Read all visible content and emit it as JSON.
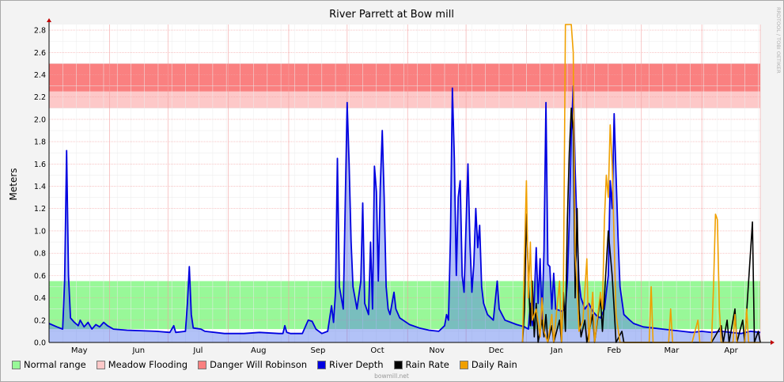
{
  "chart_data": {
    "type": "line",
    "title": "River Parrett at Bow mill",
    "watermark": "RRDTOOL / TOBI OETIKER",
    "footer": "bowmill.net",
    "ylabel": "Meters",
    "ylim": [
      0,
      2.85
    ],
    "yticks": [
      "0.0",
      "0.2",
      "0.4",
      "0.6",
      "0.8",
      "1.0",
      "1.2",
      "1.4",
      "1.6",
      "1.8",
      "2.0",
      "2.2",
      "2.4",
      "2.6",
      "2.8"
    ],
    "xlabels": [
      "May",
      "Jun",
      "Jul",
      "Aug",
      "Sep",
      "Oct",
      "Nov",
      "Dec",
      "Jan",
      "Feb",
      "Mar",
      "Apr"
    ],
    "xlim_days": [
      0,
      365
    ],
    "grid": true,
    "bands": [
      {
        "name": "Normal range",
        "from": 0.12,
        "to": 0.55,
        "color": "#98f898"
      },
      {
        "name": "Meadow Flooding",
        "from": 2.1,
        "to": 2.25,
        "color": "#fdc8c8"
      },
      {
        "name": "Danger Will Robinson",
        "from": 2.25,
        "to": 2.5,
        "color": "#fa8080"
      }
    ],
    "series": [
      {
        "name": "River Depth",
        "color": "#0000e0",
        "points": [
          [
            0,
            0.17
          ],
          [
            4,
            0.14
          ],
          [
            7,
            0.12
          ],
          [
            8,
            0.55
          ],
          [
            9,
            1.72
          ],
          [
            10,
            0.6
          ],
          [
            11,
            0.22
          ],
          [
            13,
            0.18
          ],
          [
            15,
            0.15
          ],
          [
            16,
            0.2
          ],
          [
            18,
            0.14
          ],
          [
            20,
            0.18
          ],
          [
            22,
            0.12
          ],
          [
            24,
            0.16
          ],
          [
            26,
            0.14
          ],
          [
            28,
            0.18
          ],
          [
            30,
            0.15
          ],
          [
            33,
            0.12
          ],
          [
            40,
            0.11
          ],
          [
            55,
            0.1
          ],
          [
            62,
            0.09
          ],
          [
            64,
            0.15
          ],
          [
            65,
            0.09
          ],
          [
            70,
            0.1
          ],
          [
            71,
            0.35
          ],
          [
            72,
            0.68
          ],
          [
            73,
            0.25
          ],
          [
            74,
            0.13
          ],
          [
            78,
            0.12
          ],
          [
            80,
            0.1
          ],
          [
            90,
            0.08
          ],
          [
            100,
            0.08
          ],
          [
            108,
            0.09
          ],
          [
            118,
            0.08
          ],
          [
            120,
            0.08
          ],
          [
            121,
            0.15
          ],
          [
            122,
            0.09
          ],
          [
            124,
            0.08
          ],
          [
            130,
            0.08
          ],
          [
            133,
            0.2
          ],
          [
            135,
            0.19
          ],
          [
            137,
            0.12
          ],
          [
            140,
            0.08
          ],
          [
            143,
            0.1
          ],
          [
            145,
            0.33
          ],
          [
            146,
            0.18
          ],
          [
            147,
            0.45
          ],
          [
            148,
            1.65
          ],
          [
            149,
            0.5
          ],
          [
            151,
            0.3
          ],
          [
            153,
            2.15
          ],
          [
            154,
            1.6
          ],
          [
            155,
            0.9
          ],
          [
            156,
            0.5
          ],
          [
            158,
            0.3
          ],
          [
            160,
            0.55
          ],
          [
            161,
            1.25
          ],
          [
            162,
            0.35
          ],
          [
            164,
            0.25
          ],
          [
            165,
            0.9
          ],
          [
            166,
            0.3
          ],
          [
            167,
            1.58
          ],
          [
            168,
            1.35
          ],
          [
            169,
            0.55
          ],
          [
            170,
            1.4
          ],
          [
            171,
            1.9
          ],
          [
            172,
            1.3
          ],
          [
            173,
            0.5
          ],
          [
            174,
            0.3
          ],
          [
            175,
            0.25
          ],
          [
            177,
            0.45
          ],
          [
            178,
            0.3
          ],
          [
            180,
            0.22
          ],
          [
            185,
            0.16
          ],
          [
            190,
            0.13
          ],
          [
            195,
            0.11
          ],
          [
            200,
            0.1
          ],
          [
            203,
            0.15
          ],
          [
            204,
            0.25
          ],
          [
            205,
            0.2
          ],
          [
            206,
            0.95
          ],
          [
            207,
            2.28
          ],
          [
            208,
            1.65
          ],
          [
            209,
            0.6
          ],
          [
            210,
            1.3
          ],
          [
            211,
            1.45
          ],
          [
            212,
            0.6
          ],
          [
            213,
            0.45
          ],
          [
            214,
            1.05
          ],
          [
            215,
            1.6
          ],
          [
            216,
            0.9
          ],
          [
            217,
            0.45
          ],
          [
            218,
            0.7
          ],
          [
            219,
            1.2
          ],
          [
            220,
            0.85
          ],
          [
            221,
            1.05
          ],
          [
            222,
            0.5
          ],
          [
            223,
            0.35
          ],
          [
            225,
            0.25
          ],
          [
            228,
            0.2
          ],
          [
            230,
            0.55
          ],
          [
            231,
            0.3
          ],
          [
            234,
            0.2
          ],
          [
            240,
            0.16
          ],
          [
            244,
            0.14
          ],
          [
            246,
            0.12
          ],
          [
            247,
            0.35
          ],
          [
            248,
            0.15
          ],
          [
            249,
            0.38
          ],
          [
            250,
            0.85
          ],
          [
            251,
            0.35
          ],
          [
            252,
            0.75
          ],
          [
            253,
            0.2
          ],
          [
            254,
            0.82
          ],
          [
            255,
            2.15
          ],
          [
            256,
            0.7
          ],
          [
            257,
            0.68
          ],
          [
            258,
            0.3
          ],
          [
            259,
            0.62
          ],
          [
            260,
            0.3
          ],
          [
            263,
            0.28
          ],
          [
            265,
            0.3
          ],
          [
            266,
            0.55
          ],
          [
            267,
            1.1
          ],
          [
            268,
            1.85
          ],
          [
            269,
            2.3
          ],
          [
            270,
            1.55
          ],
          [
            271,
            1.0
          ],
          [
            272,
            0.55
          ],
          [
            273,
            0.4
          ],
          [
            275,
            0.3
          ],
          [
            277,
            0.35
          ],
          [
            279,
            0.28
          ],
          [
            281,
            0.24
          ],
          [
            283,
            0.22
          ],
          [
            285,
            0.3
          ],
          [
            287,
            0.6
          ],
          [
            288,
            1.45
          ],
          [
            289,
            1.2
          ],
          [
            290,
            2.05
          ],
          [
            291,
            1.5
          ],
          [
            292,
            0.95
          ],
          [
            293,
            0.5
          ],
          [
            295,
            0.25
          ],
          [
            298,
            0.2
          ],
          [
            300,
            0.17
          ],
          [
            305,
            0.14
          ],
          [
            310,
            0.13
          ],
          [
            315,
            0.12
          ],
          [
            320,
            0.11
          ],
          [
            325,
            0.1
          ],
          [
            330,
            0.09
          ],
          [
            335,
            0.1
          ],
          [
            340,
            0.09
          ],
          [
            345,
            0.1
          ],
          [
            350,
            0.09
          ],
          [
            355,
            0.08
          ],
          [
            360,
            0.1
          ],
          [
            365,
            0.09
          ]
        ]
      },
      {
        "name": "Rain Rate",
        "color": "#000000",
        "points": [
          [
            243,
            0.0
          ],
          [
            244,
            0.3
          ],
          [
            245,
            1.15
          ],
          [
            246,
            0.6
          ],
          [
            247,
            0.15
          ],
          [
            248,
            0.55
          ],
          [
            249,
            0.05
          ],
          [
            250,
            0.35
          ],
          [
            251,
            0.0
          ],
          [
            253,
            0.2
          ],
          [
            254,
            0.05
          ],
          [
            255,
            0.25
          ],
          [
            256,
            0.0
          ],
          [
            258,
            0.15
          ],
          [
            259,
            0.0
          ],
          [
            262,
            0.2
          ],
          [
            263,
            0.0
          ],
          [
            264,
            0.45
          ],
          [
            265,
            0.1
          ],
          [
            266,
            1.1
          ],
          [
            267,
            1.7
          ],
          [
            268,
            2.1
          ],
          [
            269,
            1.9
          ],
          [
            270,
            0.4
          ],
          [
            271,
            1.2
          ],
          [
            272,
            0.3
          ],
          [
            273,
            0.05
          ],
          [
            275,
            0.2
          ],
          [
            276,
            0.0
          ],
          [
            279,
            0.25
          ],
          [
            280,
            0.0
          ],
          [
            283,
            0.4
          ],
          [
            284,
            0.1
          ],
          [
            286,
            0.7
          ],
          [
            287,
            1.0
          ],
          [
            288,
            0.8
          ],
          [
            289,
            0.6
          ],
          [
            290,
            0.3
          ],
          [
            291,
            0.0
          ],
          [
            294,
            0.1
          ],
          [
            295,
            0.0
          ],
          [
            300,
            0.0
          ],
          [
            320,
            0.0
          ],
          [
            340,
            0.0
          ],
          [
            345,
            0.15
          ],
          [
            346,
            0.0
          ],
          [
            348,
            0.2
          ],
          [
            349,
            0.0
          ],
          [
            352,
            0.3
          ],
          [
            353,
            0.0
          ],
          [
            356,
            0.2
          ],
          [
            357,
            0.0
          ],
          [
            361,
            1.08
          ],
          [
            362,
            0.0
          ],
          [
            364,
            0.1
          ],
          [
            365,
            0.0
          ]
        ]
      },
      {
        "name": "Daily Rain",
        "color": "#f0a000",
        "points": [
          [
            243,
            0.0
          ],
          [
            244,
            0.8
          ],
          [
            245,
            1.45
          ],
          [
            246,
            0.4
          ],
          [
            247,
            0.9
          ],
          [
            248,
            0.2
          ],
          [
            250,
            0.3
          ],
          [
            252,
            0.05
          ],
          [
            253,
            0.4
          ],
          [
            254,
            0.1
          ],
          [
            256,
            0.0
          ],
          [
            258,
            0.25
          ],
          [
            259,
            0.0
          ],
          [
            262,
            0.55
          ],
          [
            263,
            0.0
          ],
          [
            264,
            0.5
          ],
          [
            265,
            2.85
          ],
          [
            266,
            2.85
          ],
          [
            267,
            2.85
          ],
          [
            268,
            2.85
          ],
          [
            269,
            2.6
          ],
          [
            270,
            0.8
          ],
          [
            271,
            0.5
          ],
          [
            272,
            0.1
          ],
          [
            274,
            0.2
          ],
          [
            276,
            0.75
          ],
          [
            277,
            0.0
          ],
          [
            279,
            0.45
          ],
          [
            280,
            0.0
          ],
          [
            283,
            0.45
          ],
          [
            284,
            0.3
          ],
          [
            285,
            1.1
          ],
          [
            286,
            1.5
          ],
          [
            287,
            1.3
          ],
          [
            288,
            1.95
          ],
          [
            289,
            1.6
          ],
          [
            290,
            0.9
          ],
          [
            291,
            0.25
          ],
          [
            293,
            0.0
          ],
          [
            299,
            0.0
          ],
          [
            300,
            0.0
          ],
          [
            308,
            0.0
          ],
          [
            309,
            0.5
          ],
          [
            310,
            0.0
          ],
          [
            318,
            0.0
          ],
          [
            319,
            0.3
          ],
          [
            320,
            0.0
          ],
          [
            330,
            0.0
          ],
          [
            333,
            0.2
          ],
          [
            334,
            0.0
          ],
          [
            340,
            0.0
          ],
          [
            341,
            0.5
          ],
          [
            342,
            1.15
          ],
          [
            343,
            1.1
          ],
          [
            344,
            0.3
          ],
          [
            345,
            0.0
          ],
          [
            351,
            0.0
          ],
          [
            352,
            0.25
          ],
          [
            353,
            0.0
          ],
          [
            357,
            0.0
          ],
          [
            358,
            0.3
          ],
          [
            359,
            0.0
          ],
          [
            365,
            0.0
          ]
        ]
      }
    ],
    "legend": [
      {
        "label": "Normal range",
        "color": "#98f898"
      },
      {
        "label": "Meadow Flooding",
        "color": "#fdc8c8"
      },
      {
        "label": "Danger Will Robinson",
        "color": "#fa8080"
      },
      {
        "label": "River Depth",
        "color": "#0000e0"
      },
      {
        "label": "Rain Rate",
        "color": "#000000"
      },
      {
        "label": "Daily Rain",
        "color": "#f0a000"
      }
    ]
  }
}
